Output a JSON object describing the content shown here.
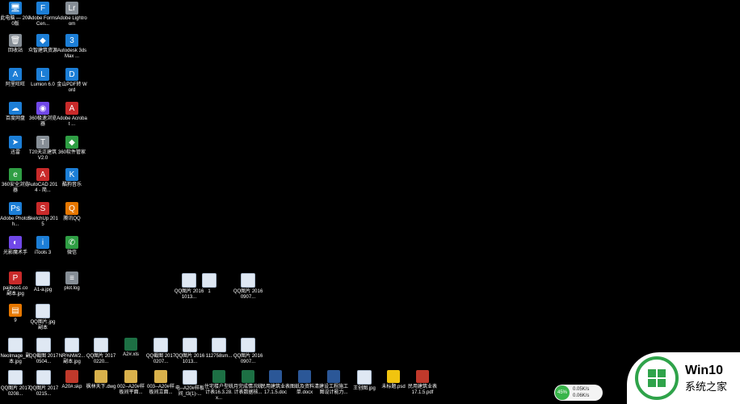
{
  "column1": [
    {
      "name": "pc",
      "label": "此电脑 — 2000版",
      "type": "app-blue",
      "glyph": "🖥"
    },
    {
      "name": "recycle",
      "label": "回收站",
      "type": "app-gray",
      "glyph": "🗑"
    },
    {
      "name": "aliwangwang",
      "label": "阿里旺旺",
      "type": "app-blue",
      "glyph": "A"
    },
    {
      "name": "baidu",
      "label": "百度网盘",
      "type": "app-blue",
      "glyph": "☁"
    },
    {
      "name": "xunlei",
      "label": "迅雷",
      "type": "app-blue",
      "glyph": "➤"
    },
    {
      "name": "360safe",
      "label": "360安全浏览器",
      "type": "app-green",
      "glyph": "e"
    },
    {
      "name": "photoshop",
      "label": "Adobe Photosh...",
      "type": "app-blue",
      "glyph": "Ps"
    },
    {
      "name": "lightwizard",
      "label": "光影魔术手",
      "type": "app-purple",
      "glyph": "◐"
    },
    {
      "name": "pajibao",
      "label": "pajiboo1.co 副本.jpg",
      "type": "app-red",
      "glyph": "P"
    },
    {
      "name": "nine",
      "label": "9",
      "type": "app-orange",
      "glyph": "▤"
    }
  ],
  "column2": [
    {
      "name": "formscentral",
      "label": "Adobe FormsCen...",
      "type": "app-blue",
      "glyph": "F"
    },
    {
      "name": "zhongzhi",
      "label": "众智建筑资源",
      "type": "app-blue",
      "glyph": "◆"
    },
    {
      "name": "lumion",
      "label": "Lumion 6.0",
      "type": "app-blue",
      "glyph": "L"
    },
    {
      "name": "360browser",
      "label": "360极速浏览器",
      "type": "app-purple",
      "glyph": "◉"
    },
    {
      "name": "t20",
      "label": "T20天正建筑 V2.0",
      "type": "app-gray",
      "glyph": "T"
    },
    {
      "name": "autocad",
      "label": "AutoCAD 2014 - 简...",
      "type": "app-red",
      "glyph": "A"
    },
    {
      "name": "sketchup",
      "label": "SketchUp 2015",
      "type": "app-red",
      "glyph": "S"
    },
    {
      "name": "itools",
      "label": "iTools 3",
      "type": "app-blue",
      "glyph": "i"
    },
    {
      "name": "a1jpg",
      "label": "A1-a.jpg",
      "type": "img",
      "glyph": ""
    },
    {
      "name": "qqjpg",
      "label": "QQ图片.jpg 副本",
      "type": "img",
      "glyph": ""
    }
  ],
  "column3": [
    {
      "name": "lightroom",
      "label": "Adobe Lightroom",
      "type": "app-gray",
      "glyph": "Lr"
    },
    {
      "name": "autodesk3ds",
      "label": "Autodesk 3ds Max ...",
      "type": "app-blue",
      "glyph": "3"
    },
    {
      "name": "jinshanpdf",
      "label": "金山PDF转 Word",
      "type": "app-blue",
      "glyph": "D"
    },
    {
      "name": "acrobat",
      "label": "Adobe Acrobat ...",
      "type": "app-red",
      "glyph": "A"
    },
    {
      "name": "360soft",
      "label": "360软件管家",
      "type": "app-green",
      "glyph": "◆"
    },
    {
      "name": "kugou",
      "label": "酷狗音乐",
      "type": "app-blue",
      "glyph": "K"
    },
    {
      "name": "tencentqq",
      "label": "腾讯QQ",
      "type": "app-orange",
      "glyph": "Q"
    },
    {
      "name": "wechat",
      "label": "微信",
      "type": "app-green",
      "glyph": "✆"
    },
    {
      "name": "plotlog",
      "label": "plot.log",
      "type": "app-gray",
      "glyph": "≡"
    }
  ],
  "middle": [
    {
      "name": "qq1",
      "label": "QQ图片 20161013...",
      "type": "img"
    },
    {
      "name": "one",
      "label": "1",
      "type": "img"
    },
    {
      "name": "qq2",
      "label": "QQ图片 20160907...",
      "type": "img"
    }
  ],
  "bottom_row1": [
    {
      "name": "neoimage",
      "label": "NeoImage_副本.jpg",
      "type": "img"
    },
    {
      "name": "qqshot1",
      "label": "QQ截图 20170504...",
      "type": "img"
    },
    {
      "name": "nrnw",
      "label": "NR%NW2... 副本.jpg",
      "type": "img"
    },
    {
      "name": "qqimg3",
      "label": "QQ图片 20170220...",
      "type": "img"
    },
    {
      "name": "a2xls",
      "label": "A2#.xls",
      "type": "xls"
    },
    {
      "name": "qqshot2",
      "label": "QQ截图 20170207...",
      "type": "img"
    },
    {
      "name": "qqimg4",
      "label": "QQ图片 20161013...",
      "type": "img"
    },
    {
      "name": "p112758",
      "label": "112758sm...",
      "type": "img"
    },
    {
      "name": "qqimg5",
      "label": "QQ图片 20160907...",
      "type": "img"
    }
  ],
  "bottom_row2": [
    {
      "name": "qqimg6",
      "label": "QQ图片 20170208...",
      "type": "img"
    },
    {
      "name": "qqimg7",
      "label": "QQ图片 20170215...",
      "type": "img"
    },
    {
      "name": "a20skp",
      "label": "A20#.skp",
      "type": "skp"
    },
    {
      "name": "fenglin",
      "label": "枫林天下.dwg",
      "type": "dwg"
    },
    {
      "name": "a20plan",
      "label": "002--A20#样板间平面...",
      "type": "dwg"
    },
    {
      "name": "a20ceil",
      "label": "003--A20#样板间立面...",
      "type": "dwg"
    },
    {
      "name": "a20sample",
      "label": "电--A20#样板间_t3(1)-...",
      "type": "img"
    },
    {
      "name": "stats",
      "label": "住宅楼户型统计表16.3.28.x...",
      "type": "xls"
    },
    {
      "name": "yuansu",
      "label": "月完成情况统计表数据核...",
      "type": "xls"
    },
    {
      "name": "minyong",
      "label": "民用建筑业表17.1.5.doc",
      "type": "doc"
    },
    {
      "name": "tuzhi",
      "label": "图纸及资料清单.docx",
      "type": "doc"
    },
    {
      "name": "jianshe",
      "label": "建设工程施工图设计能力...",
      "type": "doc"
    },
    {
      "name": "wangxiao",
      "label": "王创图.jpg",
      "type": "img"
    },
    {
      "name": "weibiaoti",
      "label": "未标题.psd",
      "type": "psd"
    },
    {
      "name": "minyongpdf",
      "label": "民用建筑业表17.1.5.pdf",
      "type": "pdf"
    }
  ],
  "network_widget": {
    "percent": "45%",
    "up": "0.05K/s",
    "down": "0.06K/s"
  },
  "watermark": {
    "line1": "Win10",
    "line2": "系统之家"
  },
  "colors": {
    "desktop_bg": "#000000",
    "logo_green": "#2fa34a"
  }
}
